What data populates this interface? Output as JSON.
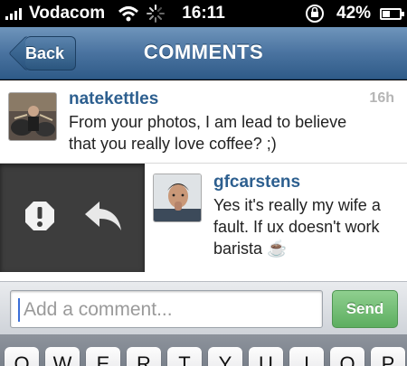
{
  "status_bar": {
    "carrier": "Vodacom",
    "time": "16:11",
    "battery_percent": "42%",
    "battery_level": 0.42,
    "icons": [
      "signal-icon",
      "wifi-icon",
      "activity-spinner-icon",
      "rotation-lock-icon",
      "battery-icon"
    ]
  },
  "nav": {
    "title": "COMMENTS",
    "back_label": "Back"
  },
  "comments": [
    {
      "username": "natekettles",
      "time": "16h",
      "text": "From your photos, I am lead to believe\nthat you really love coffee? ;)"
    },
    {
      "username": "gfcarstens",
      "text": "Yes it's really my wife a\nfault. If ux doesn't work\nbarista ☕"
    }
  ],
  "swipe_actions": [
    "report-icon",
    "reply-icon"
  ],
  "composer": {
    "placeholder": "Add a comment...",
    "send_label": "Send"
  },
  "keyboard": {
    "keys": [
      "Q",
      "W",
      "E",
      "R",
      "T",
      "Y",
      "U",
      "I",
      "O",
      "P"
    ]
  },
  "colors": {
    "nav_blue": "#4a73a0",
    "username_blue": "#2d5f8f",
    "send_green": "#5dae60",
    "swipe_dark": "#3d3d3d"
  }
}
